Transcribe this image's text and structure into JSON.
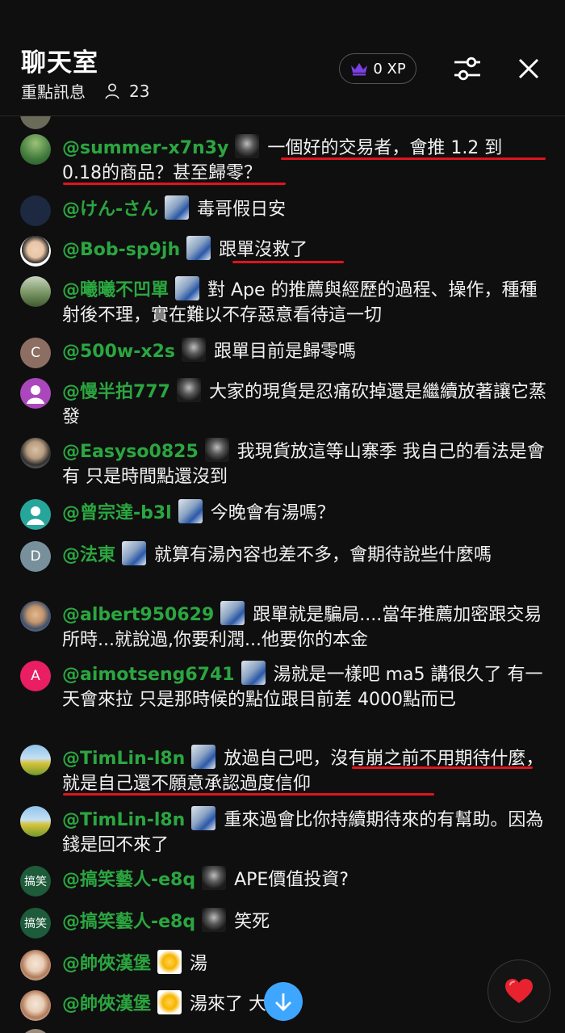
{
  "header": {
    "title": "聊天室",
    "mode_label": "重點訊息",
    "viewer_count": "23",
    "xp_label": "0 XP"
  },
  "icons": {
    "crown": "crown-icon",
    "person": "person-icon",
    "sliders": "sliders-icon",
    "close": "close-icon",
    "scroll_down": "arrow-down-icon",
    "heart": "heart-icon"
  },
  "colors": {
    "author": "#2ba640",
    "underline": "#e0141f",
    "accent_blue": "#3ea6ff",
    "crown": "#7b3fe4"
  },
  "messages": [
    {
      "author": "@summer-x7n3y",
      "text": "一個好的交易者，會推 1.2 到 0.18的商品？甚至歸零？",
      "avatar": "photo",
      "badge": "dark"
    },
    {
      "author": "@けん-さん",
      "text": "毒哥假日安",
      "avatar": "photo",
      "badge": "blue"
    },
    {
      "author": "@Bob-sp9jh",
      "text": "跟單沒救了",
      "avatar": "photo",
      "badge": "blue"
    },
    {
      "author": "@曦曦不凹單",
      "text": "對 Ape 的推薦與經歷的過程、操作，種種射後不理，實在難以不存惡意看待這一切",
      "avatar": "photo",
      "badge": "blue"
    },
    {
      "author": "@500w-x2s",
      "text": "跟單目前是歸零嗎",
      "avatar": "C",
      "badge": "dark"
    },
    {
      "author": "@慢半拍777",
      "text": "大家的現貨是忍痛砍掉還是繼續放著讓它蒸發",
      "avatar": "person",
      "badge": "dark"
    },
    {
      "author": "@Easyso0825",
      "text": "我現貨放這等山寨季 我自己的看法是會有 只是時間點還沒到",
      "avatar": "photo",
      "badge": "dark"
    },
    {
      "author": "@曾宗達-b3l",
      "text": "今晚會有湯嗎？",
      "avatar": "person",
      "badge": "blue"
    },
    {
      "author": "@法東",
      "text": "就算有湯內容也差不多，會期待說些什麼嗎",
      "avatar": "D",
      "badge": "blue"
    },
    {
      "author": "@albert950629",
      "text": "跟單就是騙局....當年推薦加密跟交易所時...就說過,你要利潤...他要你的本金",
      "avatar": "photo",
      "badge": "blue"
    },
    {
      "author": "@aimotseng6741",
      "text": "湯就是一樣吧 ma5 講很久了 有一天會來拉 只是那時候的點位跟目前差 4000點而已",
      "avatar": "A",
      "badge": "blue"
    },
    {
      "author": "@TimLin-l8n",
      "text": "放過自己吧，沒有崩之前不用期待什麼，就是自己還不願意承認過度信仰",
      "avatar": "photo",
      "badge": "blue"
    },
    {
      "author": "@TimLin-l8n",
      "text": "重來過會比你持續期待來的有幫助。因為錢是回不來了",
      "avatar": "photo",
      "badge": "blue"
    },
    {
      "author": "@搞笑藝人-e8q",
      "text": "APE價值投資?",
      "avatar": "搞笑",
      "badge": "dark"
    },
    {
      "author": "@搞笑藝人-e8q",
      "text": "笑死",
      "avatar": "搞笑",
      "badge": "dark"
    },
    {
      "author": "@帥俠漢堡",
      "text": "湯",
      "avatar": "photo",
      "badge": "yellow"
    },
    {
      "author": "@帥俠漢堡",
      "text": "湯來了 大樓",
      "avatar": "photo",
      "badge": "yellow"
    }
  ]
}
